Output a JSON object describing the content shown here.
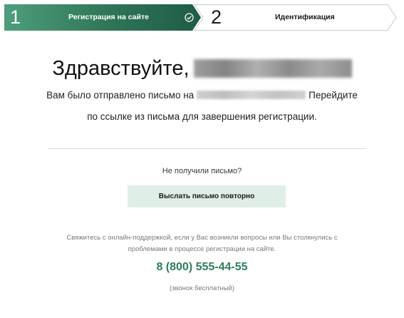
{
  "stepper": {
    "step1": {
      "number": "1",
      "label": "Регистрация на сайте",
      "status": "completed"
    },
    "step2": {
      "number": "2",
      "label": "Идентификация",
      "status": "current"
    }
  },
  "main": {
    "greeting": "Здравствуйте,",
    "message_part1": "Вам было отправлено письмо на",
    "message_part2": "Перейдите",
    "message_line2": "по ссылке из письма для завершения регистрации.",
    "not_received": "Не получили письмо?",
    "resend_button": "Выслать письмо повторно"
  },
  "support": {
    "line1": "Свяжитесь с онлайн-поддержкой, если у Вас возникли вопросы или Вы столкнулись с",
    "line2": "проблемами в процессе регистрации на сайте.",
    "phone": "8 (800) 555-44-55",
    "phone_note": "(звонок бесплатный)"
  },
  "colors": {
    "accent_green": "#2f7d5a",
    "step_active_dark": "#1f5c45",
    "step_active_light": "#4d9e7c",
    "button_bg": "#dfeee7"
  },
  "icons": {
    "check": "check-circle-icon"
  }
}
